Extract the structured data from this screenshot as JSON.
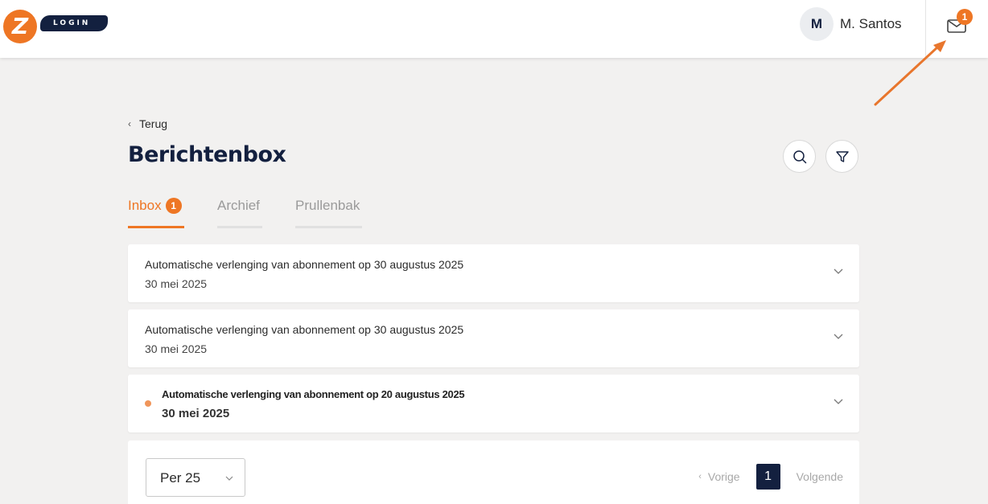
{
  "header": {
    "logo_letter": "Z",
    "logo_text": "LOGIN",
    "user_initial": "M",
    "user_name": "M. Santos",
    "mail_count": "1"
  },
  "nav": {
    "back_label": "Terug"
  },
  "page": {
    "title": "Berichtenbox"
  },
  "tabs": [
    {
      "label": "Inbox",
      "badge": "1",
      "active": true
    },
    {
      "label": "Archief",
      "active": false
    },
    {
      "label": "Prullenbak",
      "active": false
    }
  ],
  "messages": [
    {
      "subject": "Automatische verlenging van abonnement op 30 augustus 2025",
      "date": "30 mei 2025",
      "unread": false
    },
    {
      "subject": "Automatische verlenging van abonnement op 30 augustus 2025",
      "date": "30 mei 2025",
      "unread": false
    },
    {
      "subject": "Automatische verlenging van abonnement op 20 augustus 2025",
      "date": "30 mei 2025",
      "unread": true
    }
  ],
  "pagination": {
    "per_page": "Per 25",
    "prev_label": "Vorige",
    "current_page": "1",
    "next_label": "Volgende"
  },
  "colors": {
    "accent": "#ee7624",
    "navy": "#13203f",
    "background": "#f2f1f0"
  },
  "icons": [
    "search-icon",
    "filter-icon",
    "mail-icon",
    "chevron-down-icon",
    "chevron-left-icon"
  ]
}
